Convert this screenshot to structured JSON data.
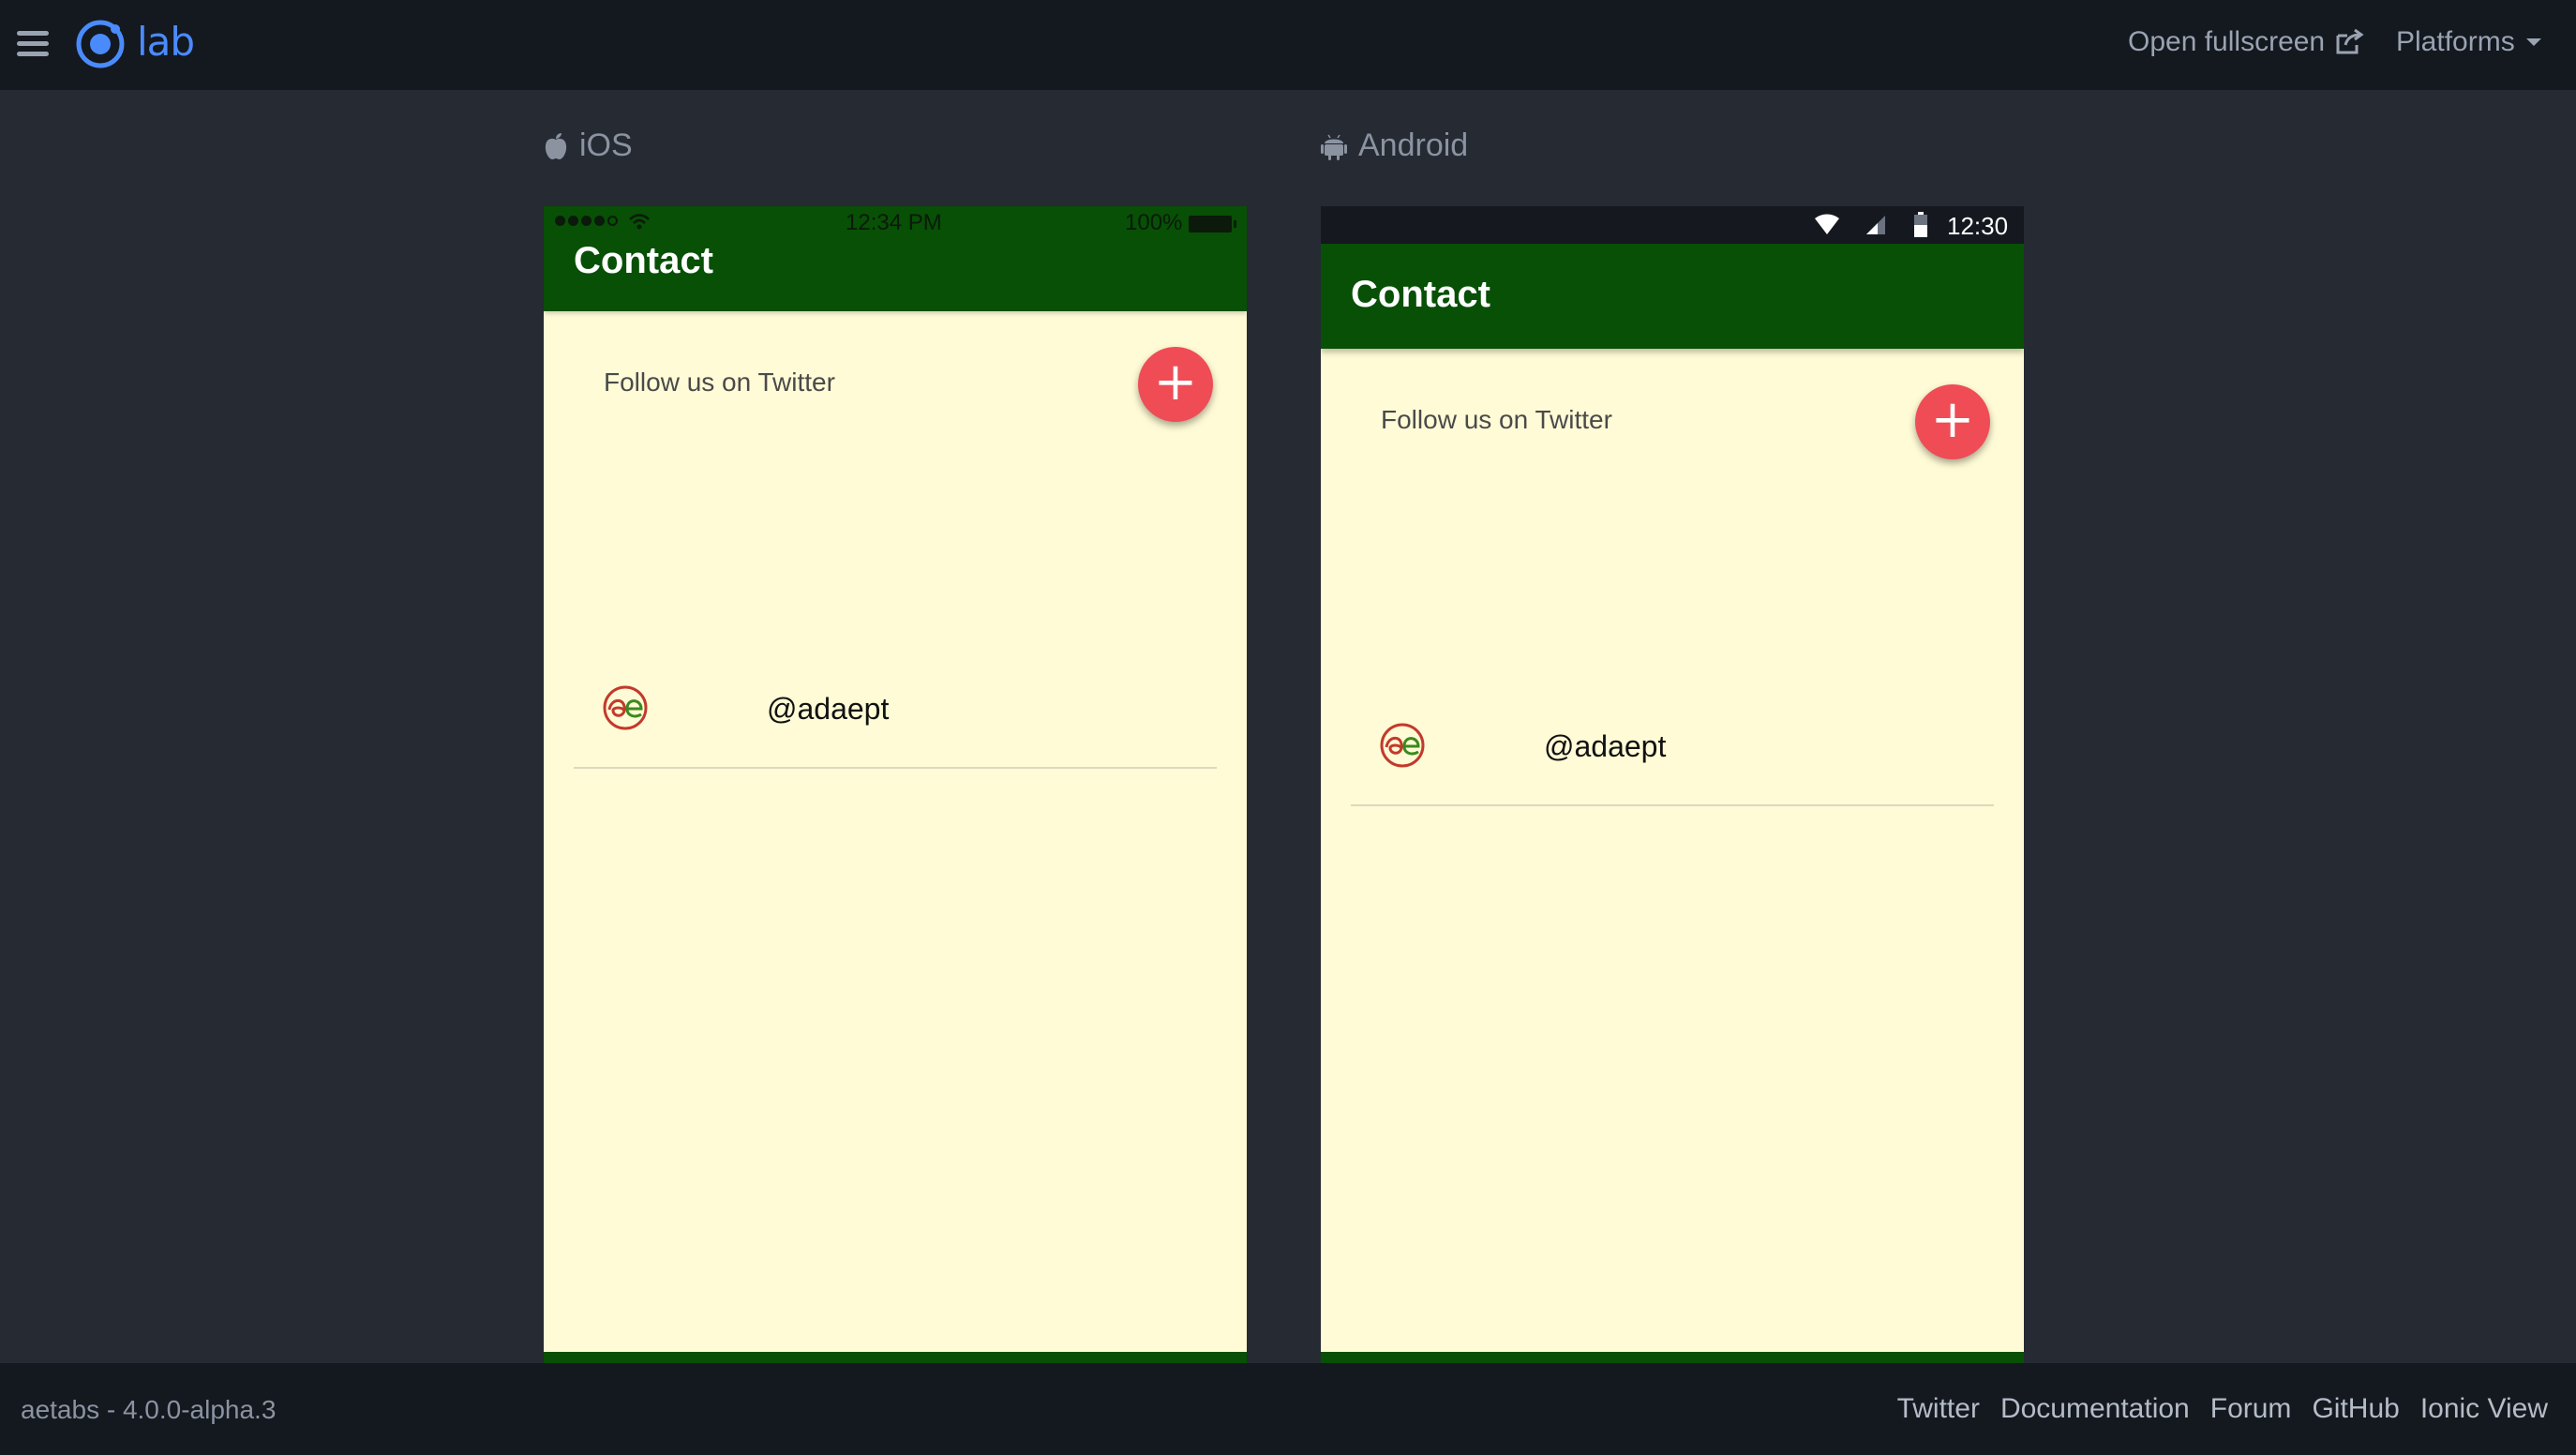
{
  "topbar": {
    "logo_text": "lab",
    "open_fullscreen": "Open fullscreen",
    "platforms": "Platforms"
  },
  "platforms": {
    "ios_label": "iOS",
    "android_label": "Android"
  },
  "ios": {
    "status_time": "12:34 PM",
    "status_battery": "100%",
    "title": "Contact",
    "follow_text": "Follow us on Twitter",
    "fab_label": "+",
    "handle": "@adaept"
  },
  "android": {
    "status_time": "12:30",
    "title": "Contact",
    "follow_text": "Follow us on Twitter",
    "fab_label": "+",
    "handle": "@adaept"
  },
  "footer": {
    "version": "aetabs - 4.0.0-alpha.3",
    "links": [
      "Twitter",
      "Documentation",
      "Forum",
      "GitHub",
      "Ionic View"
    ]
  },
  "colors": {
    "background": "#252a33",
    "bar": "#14181f",
    "header_green": "#075005",
    "content_bg": "#fffbd6",
    "fab_red": "#ef4c56",
    "ionic_blue": "#4a8bfc"
  }
}
